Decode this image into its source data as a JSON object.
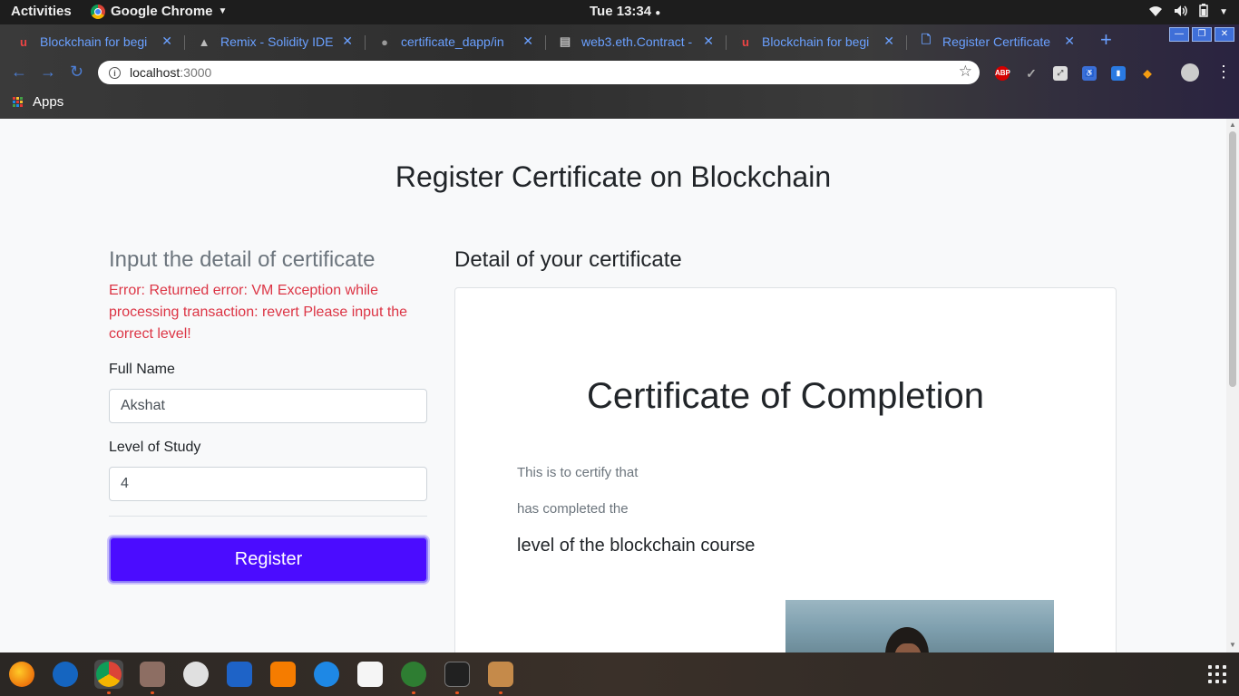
{
  "system_bar": {
    "activities": "Activities",
    "app_name": "Google Chrome",
    "clock": "Tue 13:34"
  },
  "browser": {
    "tabs": [
      {
        "title": "Blockchain for begi",
        "favicon": "udemy-icon"
      },
      {
        "title": "Remix - Solidity IDE",
        "favicon": "remix-icon"
      },
      {
        "title": "certificate_dapp/in",
        "favicon": "github-icon"
      },
      {
        "title": "web3.eth.Contract -",
        "favicon": "docs-icon"
      },
      {
        "title": "Blockchain for begi",
        "favicon": "udemy-icon"
      },
      {
        "title": "Register Certificate",
        "favicon": "page-icon"
      }
    ],
    "address": {
      "host": "localhost",
      "port": ":3000"
    },
    "bookmarks": {
      "apps_label": "Apps"
    },
    "extensions": {
      "abp_label": "ABP"
    }
  },
  "page": {
    "title": "Register Certificate on Blockchain",
    "form": {
      "heading": "Input the detail of certificate",
      "error": "Error: Returned error: VM Exception while processing transaction: revert Please input the correct level!",
      "full_name_label": "Full Name",
      "full_name_value": "Akshat",
      "level_label": "Level of Study",
      "level_value": "4",
      "register_button": "Register"
    },
    "certificate": {
      "heading": "Detail of your certificate",
      "title": "Certificate of Completion",
      "line1": "This is to certify that",
      "line2": "has completed the",
      "line3": "level of the blockchain course"
    }
  },
  "colors": {
    "primary_button": "#4b0cff",
    "error_text": "#dc3545",
    "tab_text": "#6aa0ff"
  }
}
